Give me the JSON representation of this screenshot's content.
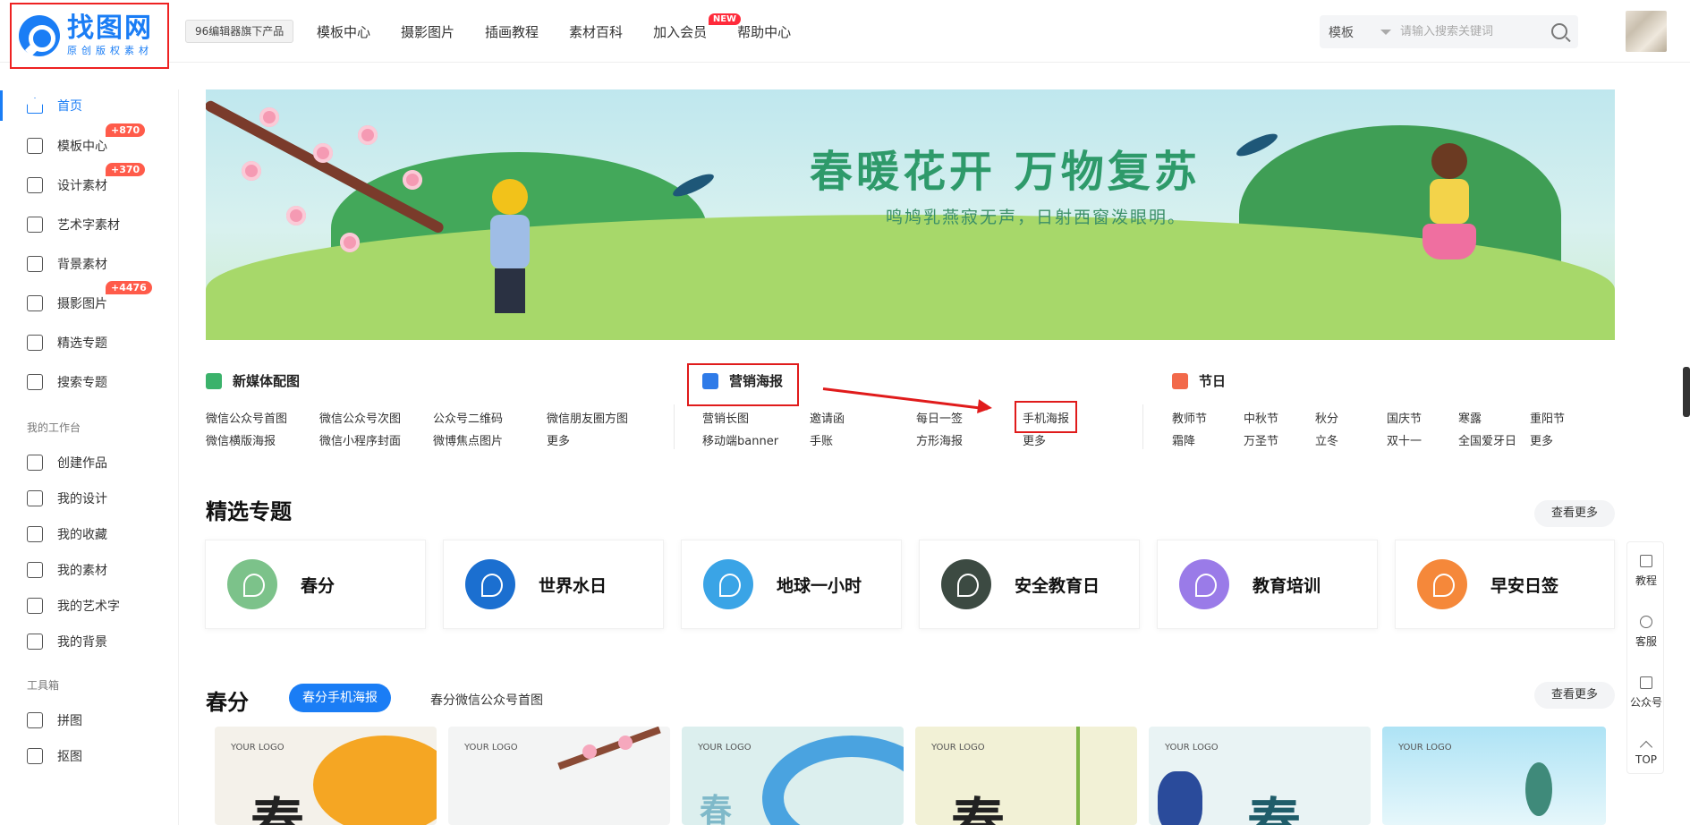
{
  "header": {
    "logo_title": "找图网",
    "logo_sub": "原创版权素材",
    "product_tag": "96编辑器旗下产品",
    "nav": [
      {
        "label": "模板中心"
      },
      {
        "label": "摄影图片"
      },
      {
        "label": "插画教程"
      },
      {
        "label": "素材百科"
      },
      {
        "label": "加入会员",
        "badge": "NEW"
      },
      {
        "label": "帮助中心"
      }
    ],
    "search_type": "模板",
    "search_placeholder": "请输入搜索关键词"
  },
  "sidebar": {
    "items": [
      {
        "label": "首页",
        "icon": "home-icon",
        "active": true
      },
      {
        "label": "模板中心",
        "icon": "template-icon",
        "badge": "+870"
      },
      {
        "label": "设计素材",
        "icon": "design-icon",
        "badge": "+370"
      },
      {
        "label": "艺术字素材",
        "icon": "font-icon"
      },
      {
        "label": "背景素材",
        "icon": "background-icon"
      },
      {
        "label": "摄影图片",
        "icon": "photo-icon",
        "badge": "+4476"
      },
      {
        "label": "精选专题",
        "icon": "topic-icon"
      },
      {
        "label": "搜索专题",
        "icon": "search-topic-icon"
      }
    ],
    "workspace_title": "我的工作台",
    "workspace": [
      {
        "label": "创建作品"
      },
      {
        "label": "我的设计"
      },
      {
        "label": "我的收藏"
      },
      {
        "label": "我的素材"
      },
      {
        "label": "我的艺术字"
      },
      {
        "label": "我的背景"
      }
    ],
    "tools_title": "工具箱",
    "tools": [
      {
        "label": "拼图"
      },
      {
        "label": "抠图"
      }
    ]
  },
  "banner": {
    "title": "春暖花开 万物复苏",
    "subtitle": "鸣鸠乳燕寂无声，日射西窗泼眼明。"
  },
  "categories": {
    "media": {
      "title": "新媒体配图",
      "links": [
        "微信公众号首图",
        "微信公众号次图",
        "公众号二维码",
        "微信朋友圈方图",
        "微信横版海报",
        "微信小程序封面",
        "微博焦点图片",
        "更多"
      ]
    },
    "marketing": {
      "title": "营销海报",
      "links": [
        "营销长图",
        "邀请函",
        "每日一签",
        "手机海报",
        "移动端banner",
        "手账",
        "方形海报",
        "更多"
      ]
    },
    "festival": {
      "title": "节日",
      "links": [
        "教师节",
        "中秋节",
        "秋分",
        "国庆节",
        "寒露",
        "重阳节",
        "霜降",
        "万圣节",
        "立冬",
        "双十一",
        "全国爱牙日",
        "更多"
      ]
    }
  },
  "featured": {
    "title": "精选专题",
    "more": "查看更多",
    "topics": [
      {
        "label": "春分",
        "color": "#7cc28a"
      },
      {
        "label": "世界水日",
        "color": "#1b6fd0"
      },
      {
        "label": "地球一小时",
        "color": "#3aa4e6"
      },
      {
        "label": "安全教育日",
        "color": "#3c4a42"
      },
      {
        "label": "教育培训",
        "color": "#9a7be8"
      },
      {
        "label": "早安日签",
        "color": "#f5883a"
      }
    ]
  },
  "toolbar": {
    "items": [
      "教程",
      "客服",
      "公众号",
      "TOP"
    ]
  },
  "spring": {
    "title": "春分",
    "tabs": [
      "春分手机海报",
      "春分微信公众号首图"
    ],
    "more": "查看更多",
    "thumbs": [
      {
        "logo": "YOUR LOGO",
        "char": "春",
        "bg": "#f4f1ea"
      },
      {
        "logo": "YOUR LOGO",
        "char": "",
        "bg": "#f3f4f4"
      },
      {
        "logo": "YOUR LOGO",
        "char": "春",
        "bg": "#dcefee"
      },
      {
        "logo": "YOUR LOGO",
        "char": "春",
        "bg": "#f2f1d6"
      },
      {
        "logo": "YOUR LOGO",
        "char": "春",
        "bg": "#e9f3f4"
      },
      {
        "logo": "YOUR LOGO",
        "char": "",
        "bg": "#cdeef7"
      }
    ]
  }
}
